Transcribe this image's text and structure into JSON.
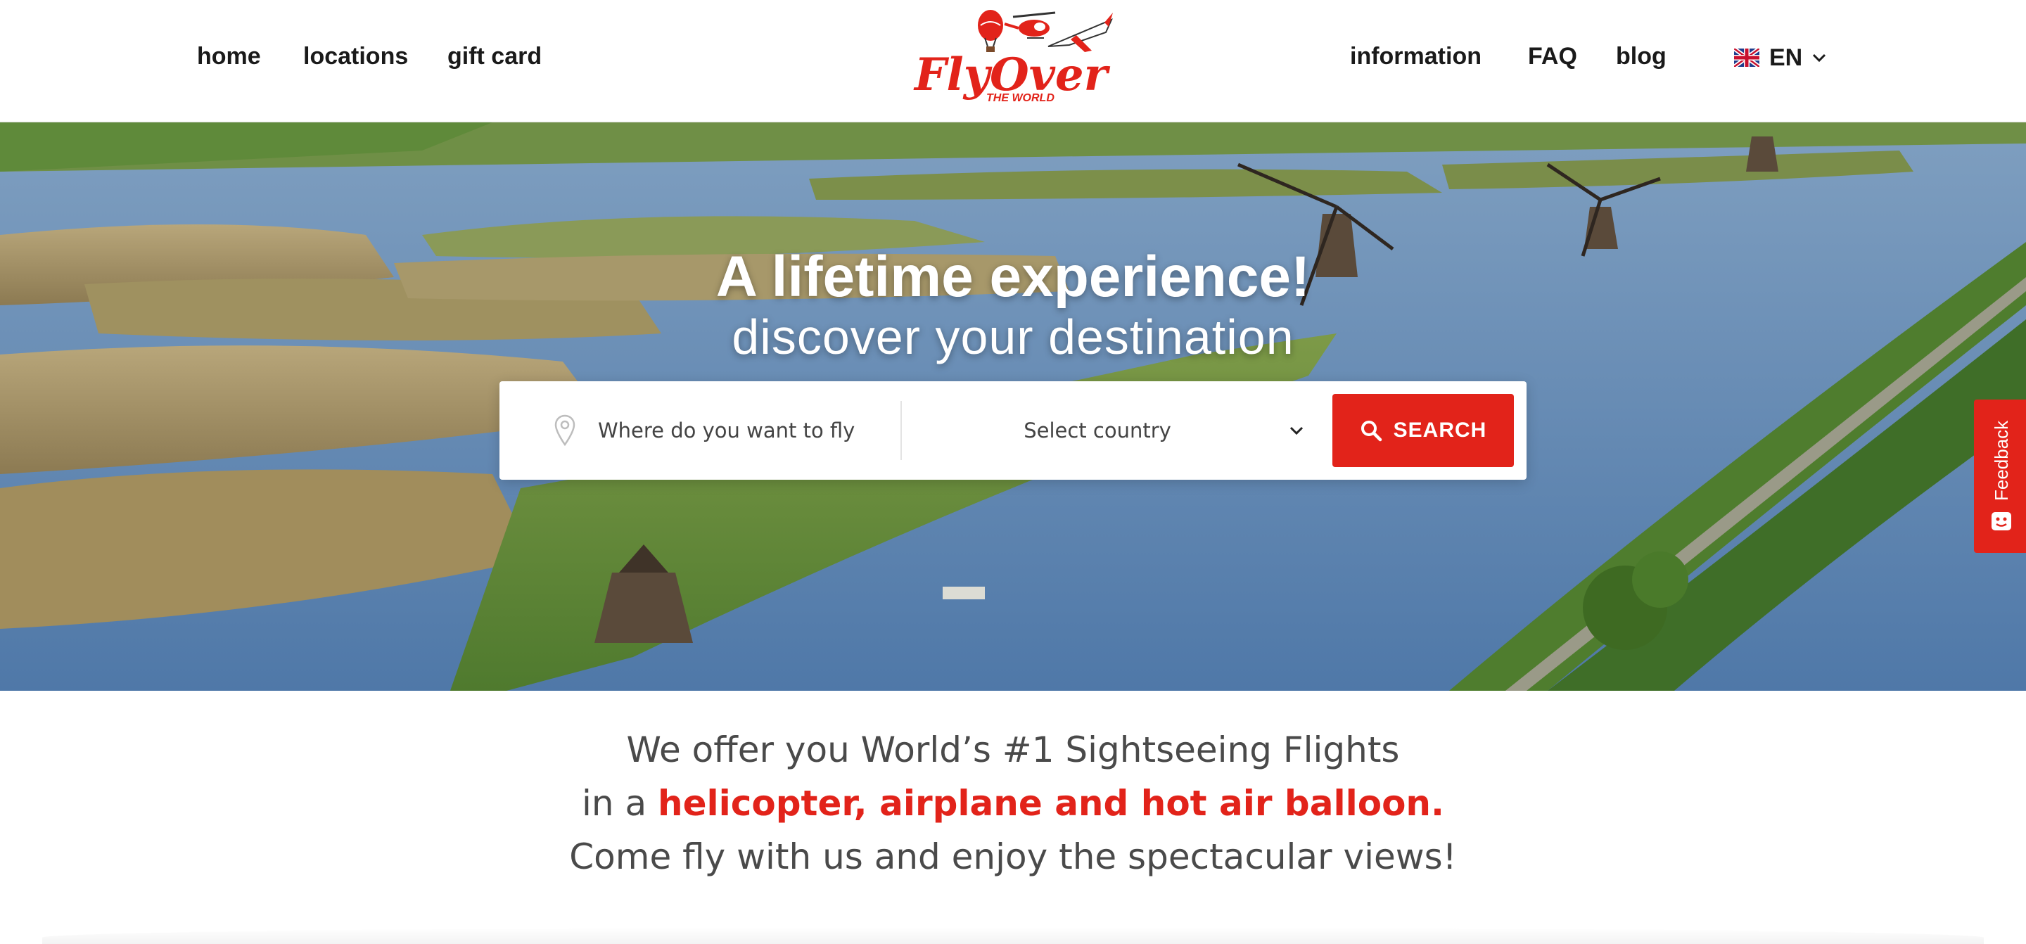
{
  "nav": {
    "left": [
      {
        "label": "home"
      },
      {
        "label": "locations"
      },
      {
        "label": "gift card"
      }
    ],
    "right": [
      {
        "label": "information"
      },
      {
        "label": "FAQ"
      },
      {
        "label": "blog"
      }
    ],
    "language": {
      "code": "EN",
      "flag_icon": "uk-flag-icon"
    }
  },
  "logo": {
    "text": "FlyOver",
    "subtext": "THE WORLD",
    "brand_color": "#e2231a"
  },
  "hero": {
    "title": "A lifetime experience!",
    "subtitle": "discover your destination"
  },
  "search": {
    "where_placeholder": "Where do you want to fly",
    "country_label": "Select country",
    "button_label": "SEARCH"
  },
  "feedback": {
    "label": "Feedback"
  },
  "tagline": {
    "line1": "We offer you World’s #1 Sightseeing Flights",
    "line2_prefix": "in a ",
    "line2_highlight": "helicopter, airplane and hot air balloon.",
    "line3": "Come fly with us and enjoy the spectacular views!"
  },
  "colors": {
    "accent": "#e2231a",
    "text": "#4a4a4a"
  }
}
